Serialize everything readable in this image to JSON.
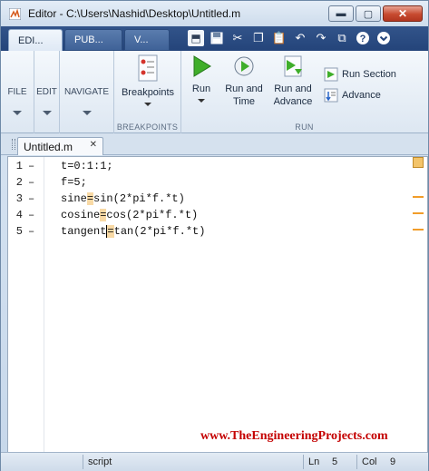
{
  "window": {
    "title": "Editor - C:\\Users\\Nashid\\Desktop\\Untitled.m",
    "controls": {
      "minimize": "▬",
      "maximize": "▢",
      "close": "✕"
    }
  },
  "tabs": [
    {
      "label": "EDI...",
      "active": true
    },
    {
      "label": "PUB...",
      "active": false
    },
    {
      "label": "V...",
      "active": false
    }
  ],
  "quick_access": [
    "undock-icon",
    "save-icon",
    "cut-icon",
    "copy-icon",
    "paste-icon",
    "undo-icon",
    "redo-icon",
    "switch-windows-icon",
    "help-icon",
    "options-icon"
  ],
  "ribbon": {
    "file": "FILE",
    "edit": "EDIT",
    "navigate": "NAVIGATE",
    "breakpoints": {
      "button": "Breakpoints",
      "section": "BREAKPOINTS"
    },
    "run": {
      "section": "RUN",
      "run": "Run",
      "run_and_time": "Run and\nTime",
      "run_and_advance": "Run and\nAdvance",
      "run_section": "Run Section",
      "advance": "Advance"
    }
  },
  "document": {
    "tab_name": "Untitled.m",
    "close": "✕"
  },
  "code_lines": [
    {
      "num": "1",
      "text": "t=0:1:1;"
    },
    {
      "num": "2",
      "text": "f=5;"
    },
    {
      "num": "3",
      "pre": "sine",
      "op": "=",
      "post": "sin(2*pi*f.*t)"
    },
    {
      "num": "4",
      "pre": "cosine",
      "op": "=",
      "post": "cos(2*pi*f.*t)"
    },
    {
      "num": "5",
      "pre": "tangent",
      "op": "=",
      "post": "tan(2*pi*f.*t)"
    }
  ],
  "watermark": "www.TheEngineeringProjects.com",
  "status": {
    "mode": "script",
    "ln_label": "Ln",
    "ln_value": "5",
    "col_label": "Col",
    "col_value": "9"
  },
  "colors": {
    "tab_bar": "#2c4f86",
    "highlight": "#f8d9a5",
    "warning": "#f19d2a",
    "watermark": "#c40000"
  }
}
